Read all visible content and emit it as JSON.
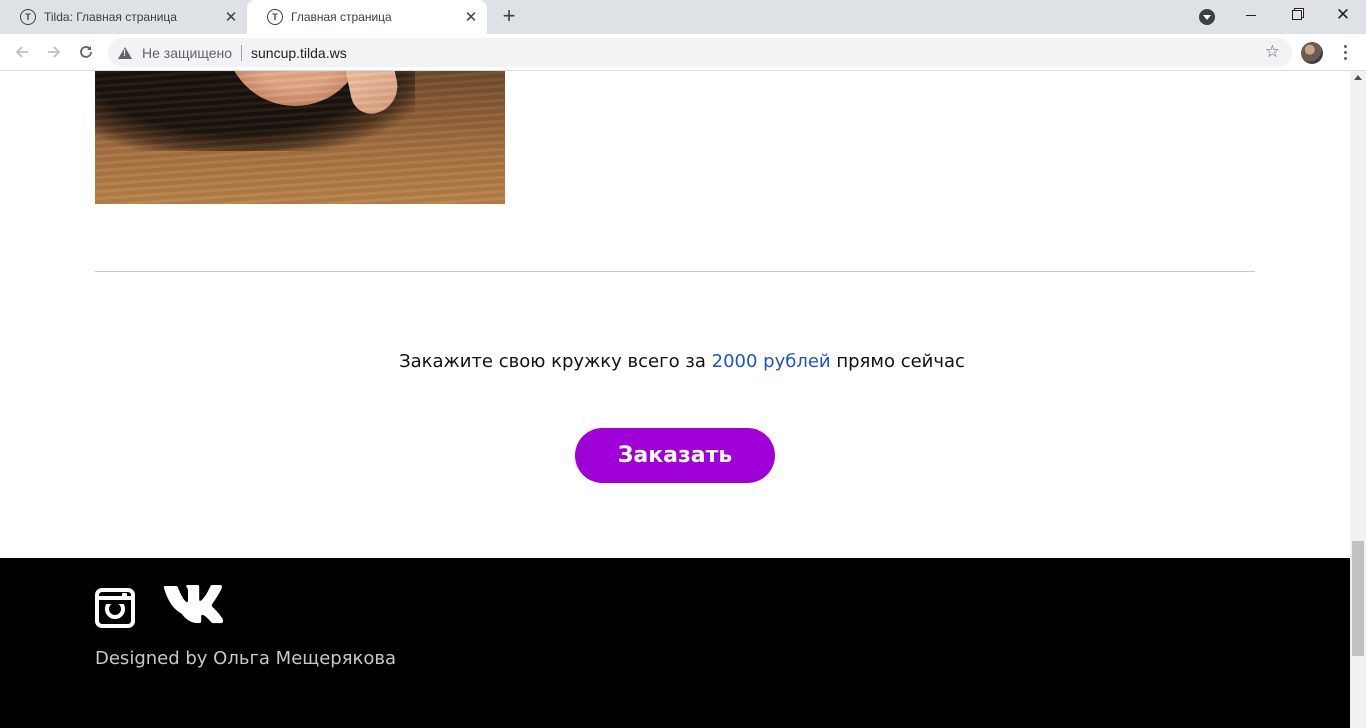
{
  "browser": {
    "tabs": [
      {
        "title": "Tilda: Главная страница",
        "favicon": "T",
        "active": false
      },
      {
        "title": "Главная страница",
        "favicon": "T",
        "active": true
      }
    ],
    "new_tab_symbol": "+",
    "close_symbol": "✕",
    "security_label": "Не защищено",
    "url": "suncup.tilda.ws"
  },
  "page": {
    "offer_prefix": "Закажите свою кружку всего за ",
    "offer_price": "2000 рублей",
    "offer_suffix": " прямо сейчас",
    "order_button": "Заказать",
    "footer": {
      "designed_by": "Designed by Ольга Мещерякова",
      "social_icons": [
        "instagram-icon",
        "vk-icon"
      ]
    }
  },
  "colors": {
    "accent_button": "#a000d8",
    "price_link": "#1d55c4",
    "footer_bg": "#000000"
  }
}
